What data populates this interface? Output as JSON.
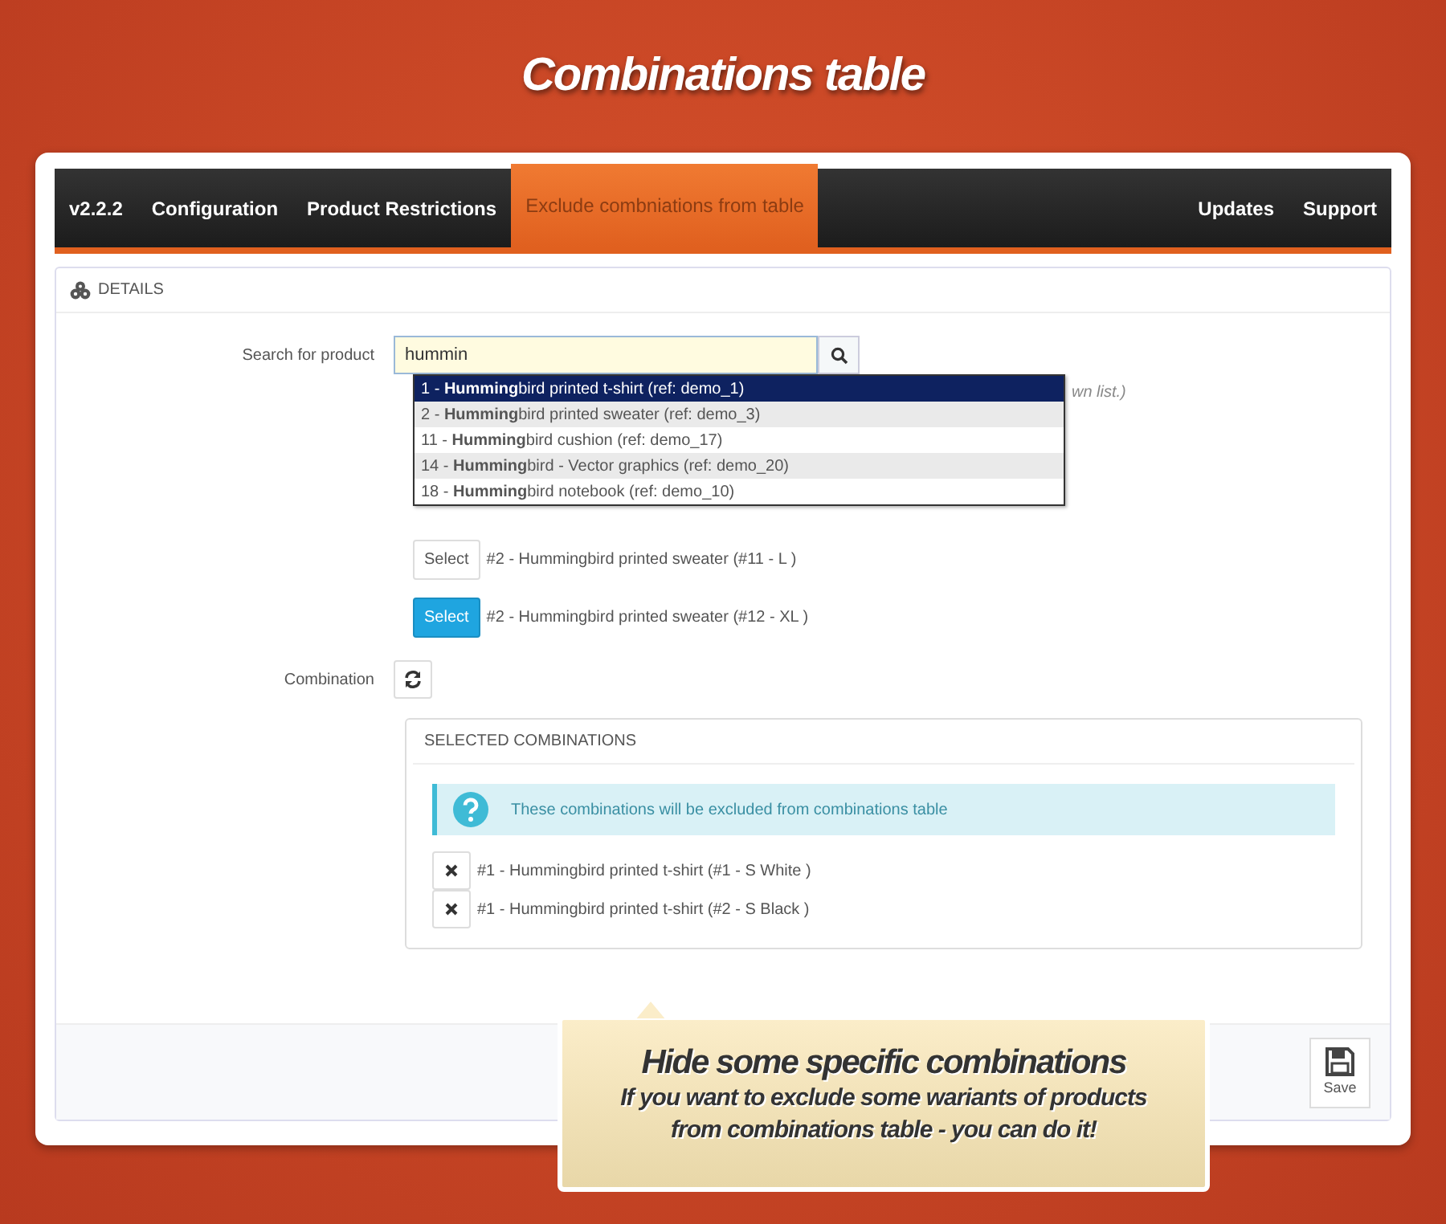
{
  "banner_title": "Combinations table",
  "nav": {
    "tabs": [
      {
        "label": "v2.2.2",
        "selected": false
      },
      {
        "label": "Configuration",
        "selected": false
      },
      {
        "label": "Product Restrictions",
        "selected": false
      },
      {
        "label": "Exclude combniations from table",
        "selected": true
      }
    ],
    "right_tabs": [
      {
        "label": "Updates",
        "selected": false
      },
      {
        "label": "Support",
        "selected": false
      }
    ]
  },
  "panel_title": "DETAILS",
  "search": {
    "label": "Search for product",
    "value": "hummin",
    "hint": "wn list.)",
    "suggestions": [
      {
        "text": "1 - **Humming**bird printed t-shirt (ref: demo_1)",
        "selected": true
      },
      {
        "text": "2 - **Humming**bird printed sweater (ref: demo_3)",
        "selected": false
      },
      {
        "text": "11 - **Humming**bird cushion (ref: demo_17)",
        "selected": false
      },
      {
        "text": "14 - **Humming**bird - Vector graphics (ref: demo_20)",
        "selected": false
      },
      {
        "text": "18 - **Humming**bird notebook (ref: demo_10)",
        "selected": false
      }
    ]
  },
  "product_rows": [
    {
      "button": "Select",
      "text": "#2 - Hummingbird printed sweater (#11 - L )",
      "selected": false
    },
    {
      "button": "Select",
      "text": "#2 - Hummingbird printed sweater (#12 - XL )",
      "selected": true
    }
  ],
  "combination_label": "Combination",
  "selected_combinations": {
    "title": "SELECTED COMBINATIONS",
    "info": "These combinations will be excluded from combinations table",
    "items": [
      "#1 - Hummingbird printed t-shirt (#1 - S White )",
      "#1 - Hummingbird printed t-shirt (#2 - S Black )"
    ]
  },
  "save_label": "Save",
  "callout": {
    "title": "Hide some specific combinations",
    "lines": [
      "If you want to exclude some wariants of products",
      "from combinations table - you can do it!"
    ]
  }
}
